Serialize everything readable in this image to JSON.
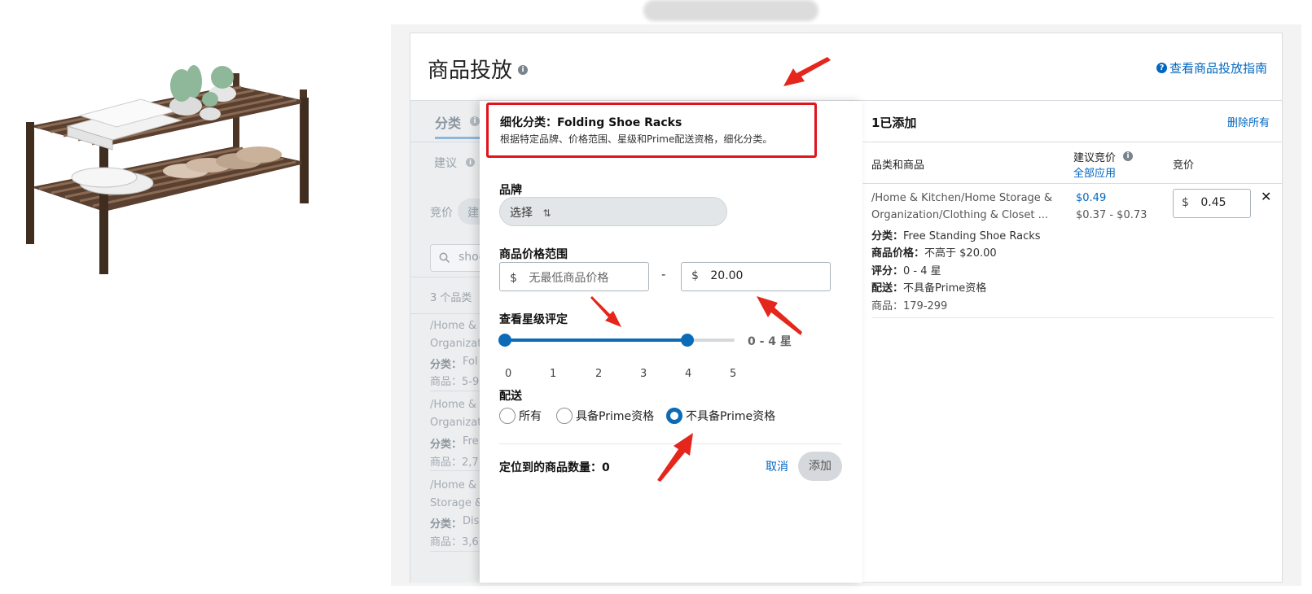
{
  "header": {
    "title": "商品投放",
    "guide_link": "查看商品投放指南"
  },
  "left_panel": {
    "tab_category": "分类",
    "suggest_label": "建议",
    "bid_label": "竞价",
    "bid_pill": "建",
    "search_value": "shoe",
    "count_label": "3 个品类",
    "items": [
      {
        "line1": "/Home & ",
        "line2": "Organizati",
        "cat_label": "分类：",
        "cat": "Fol",
        "prod": "商品：5-9"
      },
      {
        "line1": "/Home & ",
        "line2": "Organizati",
        "cat_label": "分类：",
        "cat": "Fre",
        "prod": "商品：2,7"
      },
      {
        "line1": "/Home & ",
        "line2": "Storage &",
        "cat_label": "分类：",
        "cat": "Disl",
        "prod": "商品：3,6"
      }
    ]
  },
  "modal": {
    "refine_title": "细化分类：Folding Shoe Racks",
    "refine_desc": "根据特定品牌、价格范围、星级和Prime配送资格，细化分类。",
    "brand_label": "品牌",
    "brand_select": "选择",
    "price_label": "商品价格范围",
    "price_min_placeholder": "无最低商品价格",
    "price_max_value": "20.00",
    "currency": "$",
    "price_dash": "-",
    "rating_label": "查看星级评定",
    "rating_value": "0 - 4 星",
    "rating_min": 0,
    "rating_max": 4,
    "ticks": [
      "0",
      "1",
      "2",
      "3",
      "4",
      "5"
    ],
    "delivery_label": "配送",
    "delivery_options": [
      "所有",
      "具备Prime资格",
      "不具备Prime资格"
    ],
    "delivery_selected": "不具备Prime资格",
    "count_label": "定位到的商品数量：",
    "count_value": "0",
    "cancel": "取消",
    "add": "添加"
  },
  "right_panel": {
    "title": "1已添加",
    "remove_all": "删除所有",
    "col_category": "品类和商品",
    "col_suggested": "建议竞价",
    "apply_all": "全部应用",
    "col_bid": "竞价",
    "item": {
      "path1": "/Home & Kitchen/Home Storage &",
      "path2": "Organization/Clothing & Closet ...",
      "cat_label": "分类：",
      "cat": "Free Standing Shoe Racks",
      "price_label": "商品价格：",
      "price": "不高于 $20.00",
      "rating_label": "评分：",
      "rating": "0 - 4 星",
      "delivery_label": "配送：",
      "delivery": "不具备Prime资格",
      "products": "商品：179-299",
      "suggested": "$0.49",
      "range": "$0.37 - $0.73",
      "currency": "$",
      "bid": "0.45",
      "close": "✕"
    }
  },
  "colors": {
    "accent": "#0b6bb7",
    "link": "#0066c0",
    "highlight": "#e1141c"
  },
  "icons": [
    "info-icon",
    "help-circle-icon",
    "search-icon",
    "sort-icon",
    "close-icon",
    "annotation-arrow"
  ]
}
